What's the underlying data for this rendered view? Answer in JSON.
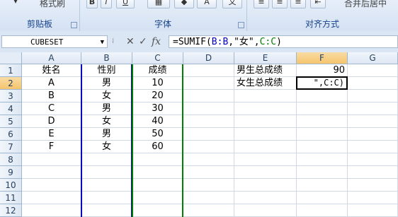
{
  "ribbon": {
    "clipboard_label": "剪贴板",
    "format_painter": "格式刷",
    "font_label": "字体",
    "align_label": "对齐方式",
    "merge_label": "合并后居中",
    "bold": "B",
    "italic": "I",
    "underline": "U"
  },
  "formula_bar": {
    "name_box": "CUBESET",
    "fx": "fx",
    "formula_prefix": "=SUMIF(",
    "formula_ref1": "B:B",
    "formula_mid": ",\"女\",",
    "formula_ref2": "C:C",
    "formula_suffix": ")"
  },
  "columns": [
    "A",
    "B",
    "C",
    "D",
    "E",
    "F",
    "G"
  ],
  "rows": [
    "1",
    "2",
    "3",
    "4",
    "5",
    "6",
    "7",
    "8",
    "9",
    "10",
    "11",
    "12"
  ],
  "cells": {
    "A1": "姓名",
    "B1": "性别",
    "C1": "成绩",
    "A2": "A",
    "B2": "男",
    "C2": "10",
    "A3": "B",
    "B3": "女",
    "C3": "20",
    "A4": "C",
    "B4": "男",
    "C4": "30",
    "A5": "D",
    "B5": "女",
    "C5": "40",
    "A6": "E",
    "B6": "男",
    "C6": "50",
    "A7": "F",
    "B7": "女",
    "C7": "60",
    "E1": "男生总成绩",
    "F1": "90",
    "E2": "女生总成绩",
    "F2": "\",C:C)"
  },
  "colors": {
    "ref_b": "#0000c0",
    "ref_c": "#008000",
    "selected_header": "#f5c46c"
  }
}
